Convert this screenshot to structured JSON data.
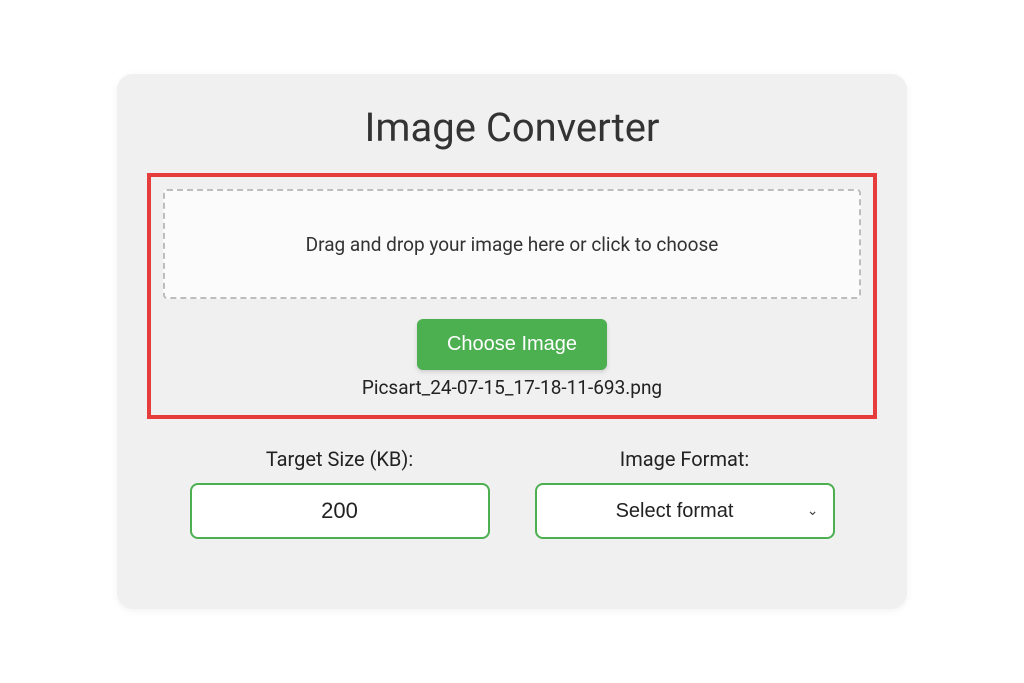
{
  "header": {
    "title": "Image Converter"
  },
  "upload": {
    "dropzone_text": "Drag and drop your image here or click to choose",
    "choose_button_label": "Choose Image",
    "selected_filename": "Picsart_24-07-15_17-18-11-693.png"
  },
  "controls": {
    "target_size": {
      "label": "Target Size (KB):",
      "value": "200"
    },
    "image_format": {
      "label": "Image Format:",
      "placeholder": "Select format"
    }
  }
}
